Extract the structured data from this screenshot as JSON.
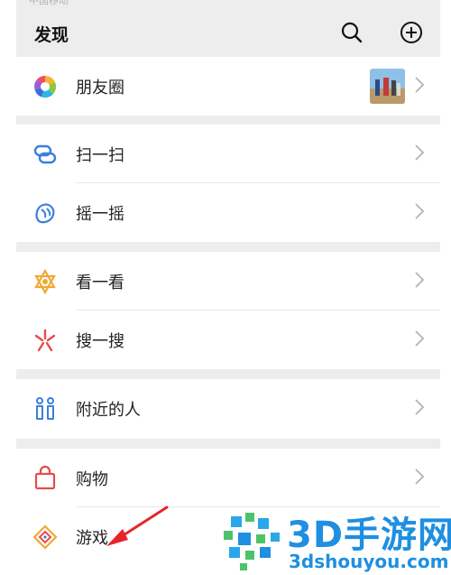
{
  "status": {
    "text": "中国移动"
  },
  "header": {
    "title": "发现",
    "search_icon": "search-icon",
    "add_icon": "plus-circle-icon"
  },
  "menu": {
    "moments": {
      "label": "朋友圈",
      "icon": "moments-aperture-icon"
    },
    "scan": {
      "label": "扫一扫",
      "icon": "scan-icon"
    },
    "shake": {
      "label": "摇一摇",
      "icon": "shake-icon"
    },
    "top_stories": {
      "label": "看一看",
      "icon": "top-stories-icon"
    },
    "search": {
      "label": "搜一搜",
      "icon": "search-sparkle-icon"
    },
    "nearby": {
      "label": "附近的人",
      "icon": "people-nearby-icon"
    },
    "shopping": {
      "label": "购物",
      "icon": "shopping-bag-icon"
    },
    "games": {
      "label": "游戏",
      "icon": "games-icon"
    }
  },
  "watermark": {
    "brand": "3D手游网",
    "url": "3dshouyou.com"
  },
  "colors": {
    "background": "#ededed",
    "watermark": "#1e8fe1",
    "annotation_arrow": "#e8232a"
  }
}
